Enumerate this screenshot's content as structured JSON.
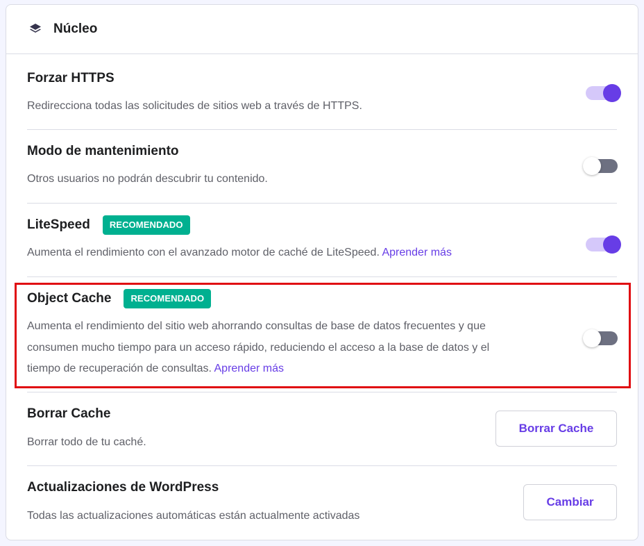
{
  "header": {
    "title": "Núcleo",
    "icon": "layers-icon"
  },
  "colors": {
    "accent": "#673de6",
    "badge": "#00b090",
    "highlight": "#e00d12"
  },
  "rows": {
    "https": {
      "title": "Forzar HTTPS",
      "desc": "Redirecciona todas las solicitudes de sitios web a través de HTTPS.",
      "toggle": "on"
    },
    "maintenance": {
      "title": "Modo de mantenimiento",
      "desc": "Otros usuarios no podrán descubrir tu contenido.",
      "toggle": "off"
    },
    "litespeed": {
      "title": "LiteSpeed",
      "badge": "RECOMENDADO",
      "desc": "Aumenta el rendimiento con el avanzado motor de caché de LiteSpeed.",
      "link": "Aprender más",
      "toggle": "on"
    },
    "object_cache": {
      "title": "Object Cache",
      "badge": "RECOMENDADO",
      "desc_line1": "Aumenta el rendimiento del sitio web ahorrando consultas de base de datos frecuentes y que",
      "desc_line2": "consumen mucho tiempo para un acceso rápido, reduciendo el acceso a la base de datos y el",
      "desc_line3": "tiempo de recuperación de consultas.",
      "link": "Aprender más",
      "toggle": "off"
    },
    "clear_cache": {
      "title": "Borrar Cache",
      "desc": "Borrar todo de tu caché.",
      "button": "Borrar Cache"
    },
    "wp_updates": {
      "title": "Actualizaciones de WordPress",
      "desc": "Todas las actualizaciones automáticas están actualmente activadas",
      "button": "Cambiar"
    }
  }
}
